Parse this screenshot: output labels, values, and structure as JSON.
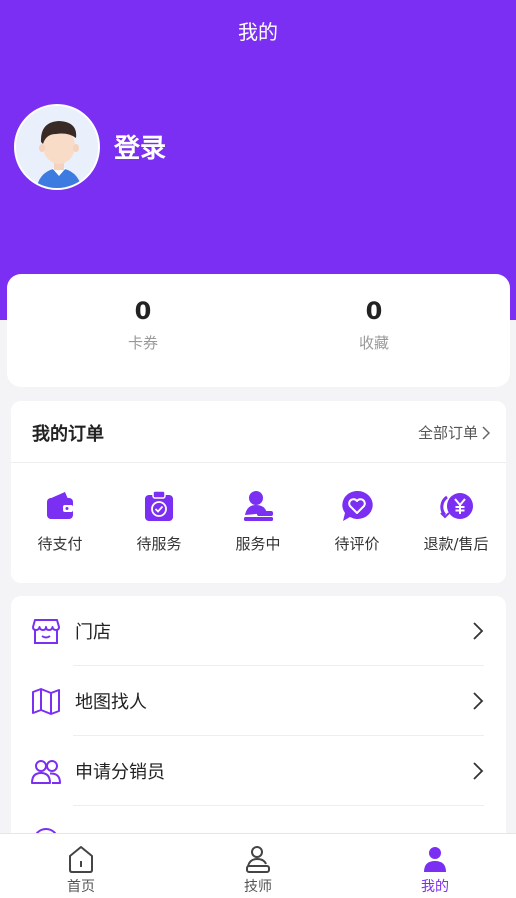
{
  "header": {
    "title": "我的",
    "login_label": "登录"
  },
  "stats": [
    {
      "value": "0",
      "label": "卡券"
    },
    {
      "value": "0",
      "label": "收藏"
    }
  ],
  "orders": {
    "title": "我的订单",
    "all_label": "全部订单",
    "items": [
      {
        "label": "待支付",
        "icon": "wallet-icon"
      },
      {
        "label": "待服务",
        "icon": "clipboard-check-icon"
      },
      {
        "label": "服务中",
        "icon": "person-service-icon"
      },
      {
        "label": "待评价",
        "icon": "heart-chat-icon"
      },
      {
        "label": "退款/售后",
        "icon": "refund-yen-icon"
      }
    ]
  },
  "menu": {
    "items": [
      {
        "label": "门店",
        "icon": "store-icon"
      },
      {
        "label": "地图找人",
        "icon": "map-icon"
      },
      {
        "label": "申请分销员",
        "icon": "users-icon"
      }
    ]
  },
  "tabbar": {
    "items": [
      {
        "label": "首页",
        "icon": "home-icon"
      },
      {
        "label": "技师",
        "icon": "technician-icon"
      },
      {
        "label": "我的",
        "icon": "profile-icon"
      }
    ],
    "active_index": 2
  },
  "colors": {
    "accent": "#7b2ff2",
    "background": "#f4f4f6",
    "card": "#ffffff"
  }
}
